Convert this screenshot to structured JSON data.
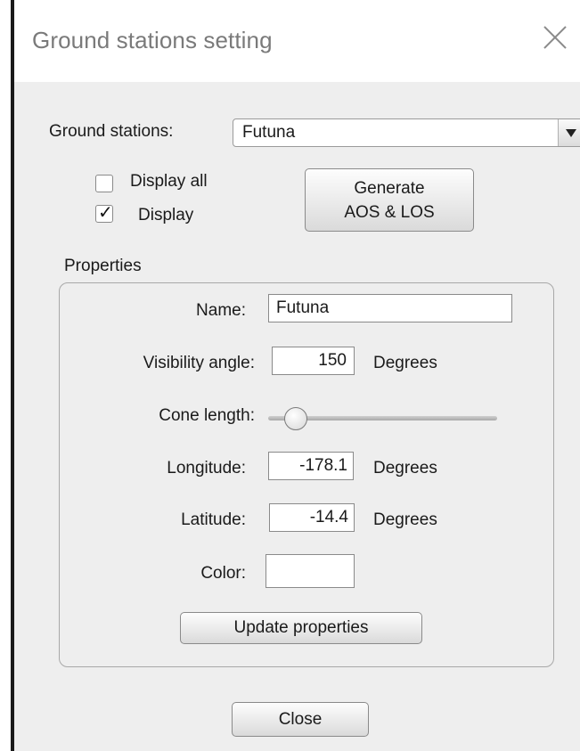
{
  "window": {
    "title": "Ground stations setting"
  },
  "ground_stations": {
    "label": "Ground stations:",
    "selected": "Futuna"
  },
  "display_all": {
    "label": "Display all",
    "checked": false
  },
  "display": {
    "label": "Display",
    "checked": true,
    "mark": "✓"
  },
  "generate_button": {
    "line1": "Generate",
    "line2": "AOS & LOS"
  },
  "properties": {
    "title": "Properties",
    "name_label": "Name:",
    "name_value": "Futuna",
    "visibility_label": "Visibility angle:",
    "visibility_value": "150",
    "visibility_unit": "Degrees",
    "cone_label": "Cone length:",
    "cone_slider_fraction": 0.08,
    "longitude_label": "Longitude:",
    "longitude_value": "-178.1",
    "longitude_unit": "Degrees",
    "latitude_label": "Latitude:",
    "latitude_value": "-14.4",
    "latitude_unit": "Degrees",
    "color_label": "Color:",
    "color_value": "#ffffff",
    "update_button": "Update properties"
  },
  "close_button": "Close"
}
